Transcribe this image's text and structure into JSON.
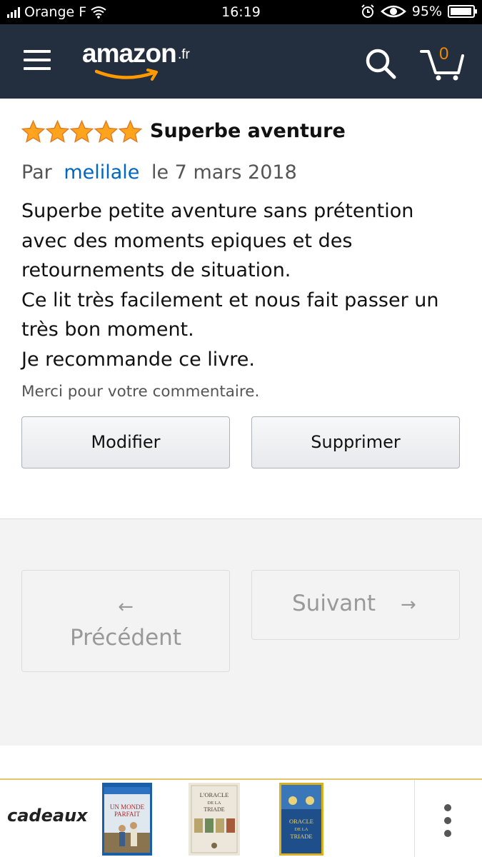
{
  "status_bar": {
    "carrier": "Orange F",
    "time": "16:19",
    "battery": "95%",
    "battery_level": 0.95
  },
  "header": {
    "logo_text": "amazon",
    "logo_tld": ".fr",
    "cart_count": "0",
    "icons": {
      "menu": "hamburger-icon",
      "search": "search-icon",
      "cart": "cart-icon"
    }
  },
  "review": {
    "rating": 5,
    "rating_max": 5,
    "title": "Superbe aventure",
    "by_prefix": "Par",
    "author": "melilale",
    "date": "le 7 mars 2018",
    "body_lines": [
      "Superbe petite aventure sans prétention",
      "avec des moments epiques et des",
      "retournements de situation.",
      "Ce lit très facilement et nous fait passer un",
      "très bon moment.",
      "Je recommande ce livre."
    ],
    "thanks": "Merci pour votre commentaire.",
    "modify_label": "Modifier",
    "delete_label": "Supprimer"
  },
  "navigation": {
    "prev_arrow": "←",
    "prev_label": "Précédent",
    "next_label": "Suivant",
    "next_arrow": "→"
  },
  "carousel": {
    "label": "cadeaux",
    "products": [
      {
        "name": "UN MONDE PARFAIT"
      },
      {
        "name": "L'ORACLE DE LA TRIADE"
      },
      {
        "name": "ORACLE DE LA TRIADE"
      }
    ],
    "more_icon": "more-vertical-icon"
  },
  "colors": {
    "header_bg": "#232f3e",
    "star": "#ffa41c",
    "link": "#0066c0",
    "cart_count": "#f08804",
    "smile": "#ff9900"
  }
}
